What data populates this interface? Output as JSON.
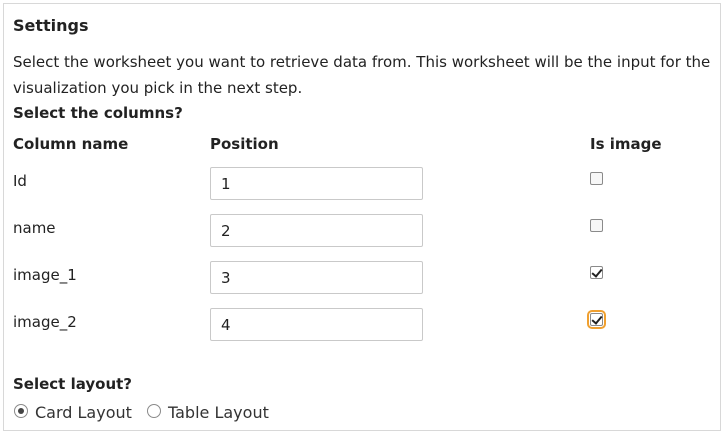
{
  "settings": {
    "title": "Settings",
    "description": "Select the worksheet you want to retrieve data from. This worksheet will be the input for the visualization you pick in the next step.",
    "columns_heading": "Select the columns?",
    "headers": {
      "column_name": "Column name",
      "position": "Position",
      "is_image": "Is image"
    },
    "rows": [
      {
        "name": "Id",
        "position": "1",
        "is_image": false
      },
      {
        "name": "name",
        "position": "2",
        "is_image": false
      },
      {
        "name": "image_1",
        "position": "3",
        "is_image": true
      },
      {
        "name": "image_2",
        "position": "4",
        "is_image": true,
        "focused": true
      }
    ],
    "layout_heading": "Select layout?",
    "layouts": [
      {
        "label": "Card Layout",
        "selected": true
      },
      {
        "label": "Table Layout",
        "selected": false
      }
    ]
  }
}
